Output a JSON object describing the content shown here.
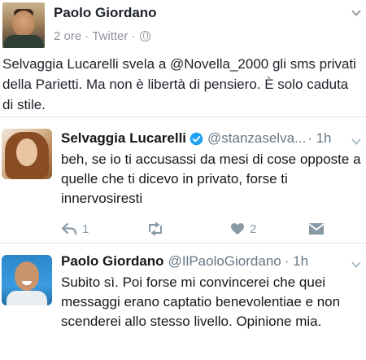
{
  "post": {
    "author": "Paolo Giordano",
    "meta_time": "2 ore",
    "meta_sep1": "·",
    "meta_source": "Twitter",
    "meta_sep2": "·",
    "body": "Selvaggia Lucarelli svela a @Novella_2000 gli sms privati della Parietti. Ma non è libertà di pensiero. È solo caduta di stile."
  },
  "tweets": [
    {
      "name": "Selvaggia Lucarelli",
      "verified": true,
      "handle": "@stanzaselva...",
      "time": "· 1h",
      "text": "beh, se io ti accusassi da mesi di cose opposte a quelle che ti dicevo in privato, forse ti innervosiresti",
      "reply_count": "1",
      "like_count": "2"
    },
    {
      "name": "Paolo Giordano",
      "verified": false,
      "handle": "@IlPaoloGiordano",
      "time": "· 1h",
      "text": "Subito sì. Poi forse mi convincerei che quei messaggi erano captatio benevolentiae e non scenderei allo stesso livello. Opinione mia."
    }
  ],
  "icons": {
    "verified_color": "#1da1f2",
    "action_color": "#8899a6"
  }
}
